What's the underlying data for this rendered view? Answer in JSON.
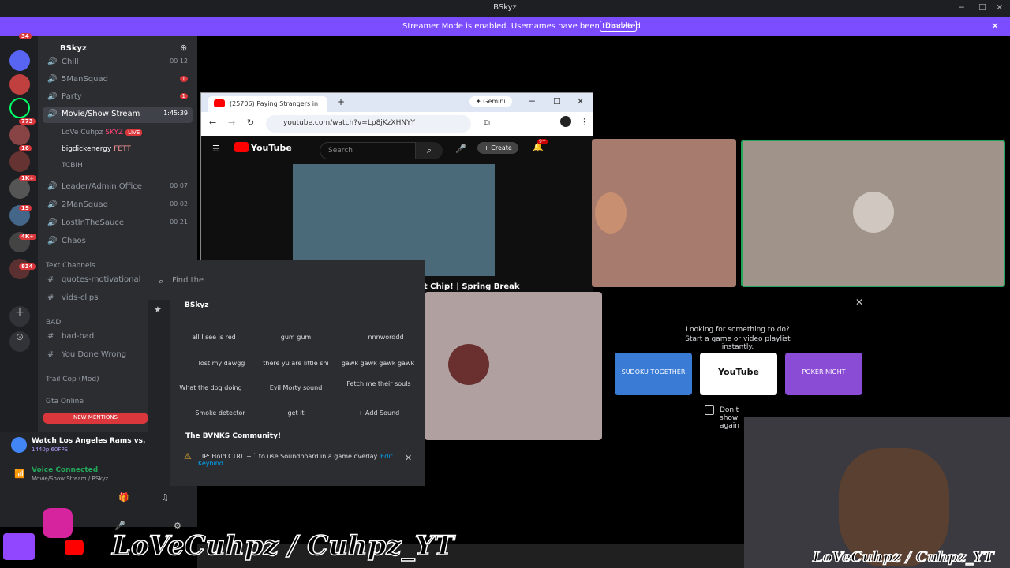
{
  "titlebar": {
    "title": "BSkyz"
  },
  "banner": {
    "message": "Streamer Mode is enabled. Usernames have been truncated.",
    "button": "Disable"
  },
  "rail": {
    "badges": [
      "34",
      "773",
      "16",
      "1K+",
      "19",
      "4K+",
      "834"
    ]
  },
  "server": {
    "name": "BSkyz",
    "channels": [
      {
        "name": "Chill",
        "right": "00 12"
      },
      {
        "name": "5ManSquad",
        "badge": "1"
      },
      {
        "name": "Party",
        "badge": "1"
      },
      {
        "name": "Movie/Show Stream",
        "right": "1:45:39"
      },
      {
        "name": "Leader/Admin Office",
        "right": "00 07"
      },
      {
        "name": "2ManSquad",
        "right": "00 02"
      },
      {
        "name": "LostInTheSauce",
        "right": "00 21"
      },
      {
        "name": "Chaos"
      }
    ],
    "voice_users": [
      {
        "name": "LoVe Cuhpz",
        "tag": "SKYZ",
        "live": "LIVE"
      },
      {
        "name": "bigdickenergy",
        "tag": "FETT"
      },
      {
        "name": "TCBIH"
      }
    ],
    "text_cat": "Text Channels",
    "text_channels": [
      "quotes-motivational",
      "vids-clips"
    ],
    "bad_cat": "BAD",
    "bad_channels": [
      "bad-bad",
      "You Done Wrong"
    ],
    "cat3": "Trail Cop (Mod)",
    "cat4": "Gta Online",
    "mentions": "NEW MENTIONS"
  },
  "user": {
    "activity": "Watch Los Angeles Rams vs. C...",
    "activity_sub": "1440p 60FPS",
    "voice": "Voice Connected",
    "voice_sub": "Movie/Show Stream / BSkyz"
  },
  "chrome": {
    "tab": "(25706) Paying Strangers in",
    "gemini": "Gemini",
    "url": "youtube.com/watch?v=Lp8jKzXHNYY"
  },
  "youtube": {
    "logo": "YouTube",
    "search": "Search",
    "create": "Create",
    "notif": "9+",
    "title": "Paying Strangers in Miami to Eat World's Hottest Chip! | Spring Break"
  },
  "soundboard": {
    "find": "Find the",
    "server": "BSkyz",
    "sounds": [
      "all I see is red",
      "gum gum",
      "nnnworddd",
      "lost my dawgg",
      "there yu are little shi",
      "gawk gawk gawk gawk",
      "What the dog doing",
      "Evil Morty sound",
      "Fetch me their souls",
      "Smoke detector",
      "get it",
      "Add Sound"
    ],
    "community": "The BVNKS Community!",
    "tip": "TIP: Hold CTRL + ` to use Soundboard in a game overlay.",
    "tip_link": "Edit Keybind."
  },
  "activity": {
    "line1": "Looking for something to do?",
    "line2": "Start a game or video playlist instantly.",
    "cards": [
      "SUDOKU TOGETHER",
      "YouTube",
      "POKER NIGHT"
    ],
    "dont_show": "Don't show again"
  },
  "watermark": {
    "left": "LoVeCuhpz / Cuhpz_YT",
    "right": "LoVeCuhpz / Cuhpz_YT"
  },
  "colors": {
    "banner": "#7c4dff",
    "tile1": "#a87b6f",
    "tile2": "#a0948a",
    "tile3": "#b0a0a0"
  }
}
